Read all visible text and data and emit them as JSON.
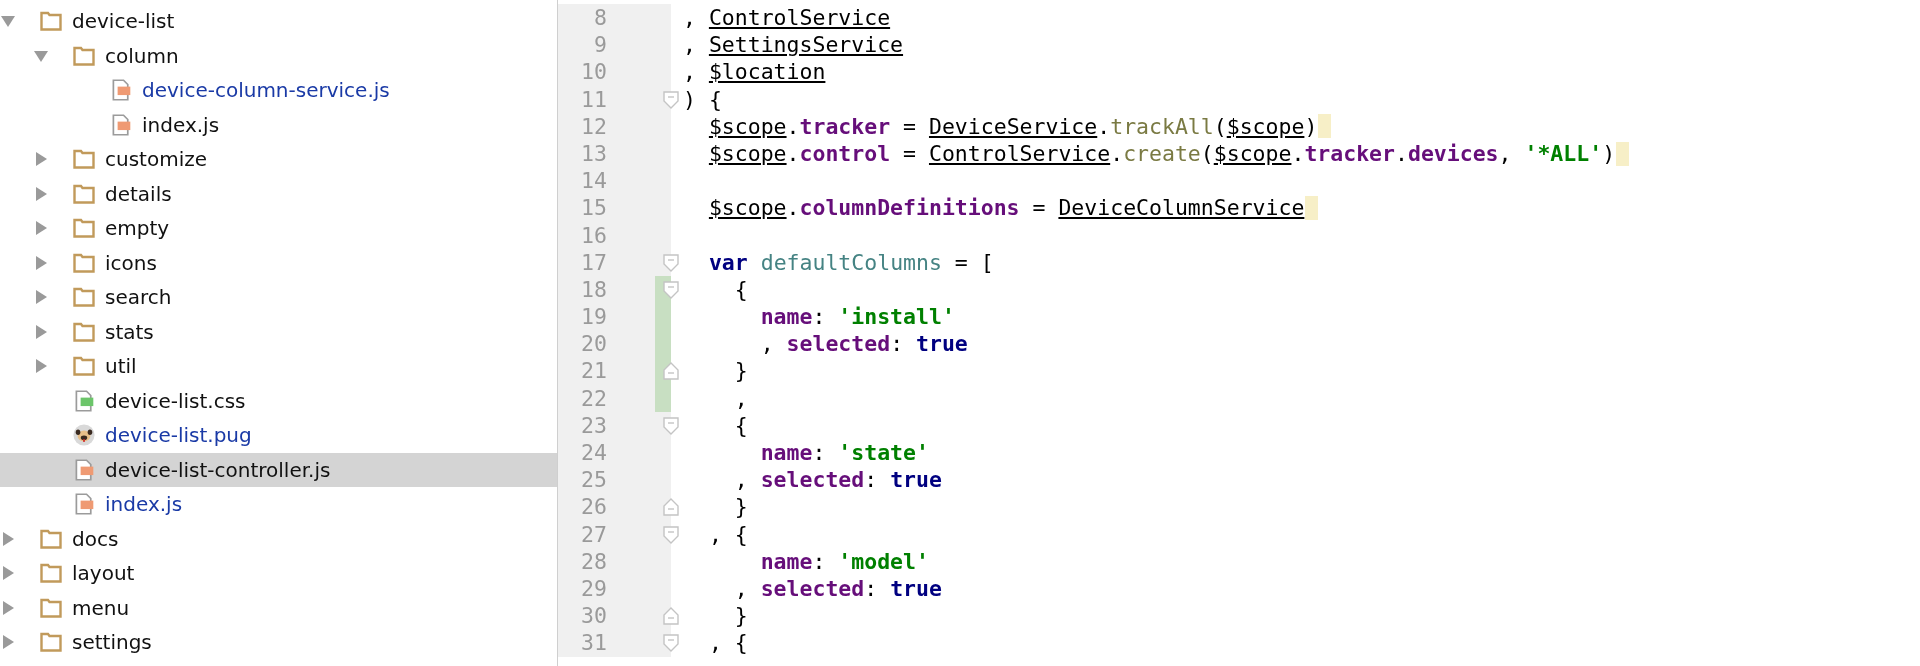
{
  "project_tree": [
    {
      "name": "device-list",
      "kind": "folder",
      "expanded": true,
      "selected": false,
      "modified": false,
      "children": [
        {
          "name": "column",
          "kind": "folder",
          "expanded": true,
          "selected": false,
          "modified": false,
          "children": [
            {
              "name": "device-column-service.js",
              "kind": "js",
              "selected": false,
              "modified": true
            },
            {
              "name": "index.js",
              "kind": "js",
              "selected": false,
              "modified": false
            }
          ]
        },
        {
          "name": "customize",
          "kind": "folder",
          "expanded": false,
          "selected": false,
          "modified": false
        },
        {
          "name": "details",
          "kind": "folder",
          "expanded": false,
          "selected": false,
          "modified": false
        },
        {
          "name": "empty",
          "kind": "folder",
          "expanded": false,
          "selected": false,
          "modified": false
        },
        {
          "name": "icons",
          "kind": "folder",
          "expanded": false,
          "selected": false,
          "modified": false
        },
        {
          "name": "search",
          "kind": "folder",
          "expanded": false,
          "selected": false,
          "modified": false
        },
        {
          "name": "stats",
          "kind": "folder",
          "expanded": false,
          "selected": false,
          "modified": false
        },
        {
          "name": "util",
          "kind": "folder",
          "expanded": false,
          "selected": false,
          "modified": false
        },
        {
          "name": "device-list.css",
          "kind": "css",
          "selected": false,
          "modified": false
        },
        {
          "name": "device-list.pug",
          "kind": "pug",
          "selected": false,
          "modified": true
        },
        {
          "name": "device-list-controller.js",
          "kind": "js",
          "selected": true,
          "modified": false
        },
        {
          "name": "index.js",
          "kind": "js",
          "selected": false,
          "modified": true
        }
      ]
    },
    {
      "name": "docs",
      "kind": "folder",
      "expanded": false,
      "selected": false,
      "modified": false
    },
    {
      "name": "layout",
      "kind": "folder",
      "expanded": false,
      "selected": false,
      "modified": false
    },
    {
      "name": "menu",
      "kind": "folder",
      "expanded": false,
      "selected": false,
      "modified": false
    },
    {
      "name": "settings",
      "kind": "folder",
      "expanded": false,
      "selected": false,
      "modified": false
    }
  ],
  "editor": {
    "lines": [
      {
        "number": "8",
        "fold_start": false,
        "fold_end": false,
        "changed": false,
        "highlight": false,
        "tokens": [
          {
            "t": ", ",
            "kind": "plain"
          },
          {
            "t": "ControlService",
            "kind": "ref"
          }
        ]
      },
      {
        "number": "9",
        "fold_start": false,
        "fold_end": false,
        "changed": false,
        "highlight": false,
        "tokens": [
          {
            "t": ", ",
            "kind": "plain"
          },
          {
            "t": "SettingsService",
            "kind": "ref"
          }
        ]
      },
      {
        "number": "10",
        "fold_start": false,
        "fold_end": false,
        "changed": false,
        "highlight": false,
        "tokens": [
          {
            "t": ", ",
            "kind": "plain"
          },
          {
            "t": "$location",
            "kind": "ref"
          }
        ]
      },
      {
        "number": "11",
        "fold_start": true,
        "fold_end": false,
        "changed": false,
        "highlight": false,
        "tokens": [
          {
            "t": ") {",
            "kind": "plain"
          }
        ]
      },
      {
        "number": "12",
        "fold_start": false,
        "fold_end": false,
        "changed": false,
        "highlight": true,
        "tokens": [
          {
            "t": "  $scope",
            "kind": "ref"
          },
          {
            "t": ".",
            "kind": "plain"
          },
          {
            "t": "tracker",
            "kind": "prop"
          },
          {
            "t": " = ",
            "kind": "plain"
          },
          {
            "t": "DeviceService",
            "kind": "ref"
          },
          {
            "t": ".",
            "kind": "plain"
          },
          {
            "t": "trackAll",
            "kind": "fn"
          },
          {
            "t": "(",
            "kind": "plain"
          },
          {
            "t": "$scope",
            "kind": "ref"
          },
          {
            "t": ")",
            "kind": "plain"
          }
        ]
      },
      {
        "number": "13",
        "fold_start": false,
        "fold_end": false,
        "changed": false,
        "highlight": true,
        "tokens": [
          {
            "t": "  $scope",
            "kind": "ref"
          },
          {
            "t": ".",
            "kind": "plain"
          },
          {
            "t": "control",
            "kind": "prop"
          },
          {
            "t": " = ",
            "kind": "plain"
          },
          {
            "t": "ControlService",
            "kind": "ref"
          },
          {
            "t": ".",
            "kind": "plain"
          },
          {
            "t": "create",
            "kind": "fn"
          },
          {
            "t": "(",
            "kind": "plain"
          },
          {
            "t": "$scope",
            "kind": "ref"
          },
          {
            "t": ".",
            "kind": "plain"
          },
          {
            "t": "tracker",
            "kind": "prop"
          },
          {
            "t": ".",
            "kind": "plain"
          },
          {
            "t": "devices",
            "kind": "prop"
          },
          {
            "t": ", ",
            "kind": "plain"
          },
          {
            "t": "'*ALL'",
            "kind": "str"
          },
          {
            "t": ")",
            "kind": "plain"
          }
        ]
      },
      {
        "number": "14",
        "fold_start": false,
        "fold_end": false,
        "changed": false,
        "highlight": false
      },
      {
        "number": "15",
        "fold_start": false,
        "fold_end": false,
        "changed": false,
        "highlight": true,
        "tokens": [
          {
            "t": "  $scope",
            "kind": "ref"
          },
          {
            "t": ".",
            "kind": "plain"
          },
          {
            "t": "columnDefinitions",
            "kind": "prop"
          },
          {
            "t": " = ",
            "kind": "plain"
          },
          {
            "t": "DeviceColumnService",
            "kind": "ref"
          }
        ]
      },
      {
        "number": "16",
        "fold_start": false,
        "fold_end": false,
        "changed": false,
        "highlight": false
      },
      {
        "number": "17",
        "fold_start": true,
        "fold_end": false,
        "changed": false,
        "highlight": false,
        "tokens": [
          {
            "t": "  var",
            "kind": "kw"
          },
          {
            "t": " defaultColumns",
            "kind": "var"
          },
          {
            "t": " = [",
            "kind": "plain"
          }
        ]
      },
      {
        "number": "18",
        "fold_start": true,
        "fold_end": false,
        "changed": true,
        "highlight": false,
        "tokens": [
          {
            "t": "    {",
            "kind": "plain"
          }
        ]
      },
      {
        "number": "19",
        "fold_start": false,
        "fold_end": false,
        "changed": true,
        "highlight": false,
        "tokens": [
          {
            "t": "      name",
            "kind": "prop"
          },
          {
            "t": ": ",
            "kind": "plain"
          },
          {
            "t": "'install'",
            "kind": "str"
          }
        ]
      },
      {
        "number": "20",
        "fold_start": false,
        "fold_end": false,
        "changed": true,
        "highlight": false,
        "tokens": [
          {
            "t": "      , ",
            "kind": "plain"
          },
          {
            "t": "selected",
            "kind": "prop"
          },
          {
            "t": ": ",
            "kind": "plain"
          },
          {
            "t": "true",
            "kind": "kw"
          }
        ]
      },
      {
        "number": "21",
        "fold_start": false,
        "fold_end": true,
        "changed": true,
        "highlight": false,
        "tokens": [
          {
            "t": "    }",
            "kind": "plain"
          }
        ]
      },
      {
        "number": "22",
        "fold_start": false,
        "fold_end": false,
        "changed": true,
        "highlight": false,
        "tokens": [
          {
            "t": "    ,",
            "kind": "plain"
          }
        ]
      },
      {
        "number": "23",
        "fold_start": true,
        "fold_end": false,
        "changed": false,
        "highlight": false,
        "tokens": [
          {
            "t": "    {",
            "kind": "plain"
          }
        ]
      },
      {
        "number": "24",
        "fold_start": false,
        "fold_end": false,
        "changed": false,
        "highlight": false,
        "tokens": [
          {
            "t": "      name",
            "kind": "prop"
          },
          {
            "t": ": ",
            "kind": "plain"
          },
          {
            "t": "'state'",
            "kind": "str"
          }
        ]
      },
      {
        "number": "25",
        "fold_start": false,
        "fold_end": false,
        "changed": false,
        "highlight": false,
        "tokens": [
          {
            "t": "    , ",
            "kind": "plain"
          },
          {
            "t": "selected",
            "kind": "prop"
          },
          {
            "t": ": ",
            "kind": "plain"
          },
          {
            "t": "true",
            "kind": "kw"
          }
        ]
      },
      {
        "number": "26",
        "fold_start": false,
        "fold_end": true,
        "changed": false,
        "highlight": false,
        "tokens": [
          {
            "t": "    }",
            "kind": "plain"
          }
        ]
      },
      {
        "number": "27",
        "fold_start": true,
        "fold_end": false,
        "changed": false,
        "highlight": false,
        "tokens": [
          {
            "t": "  , {",
            "kind": "plain"
          }
        ]
      },
      {
        "number": "28",
        "fold_start": false,
        "fold_end": false,
        "changed": false,
        "highlight": false,
        "tokens": [
          {
            "t": "      name",
            "kind": "prop"
          },
          {
            "t": ": ",
            "kind": "plain"
          },
          {
            "t": "'model'",
            "kind": "str"
          }
        ]
      },
      {
        "number": "29",
        "fold_start": false,
        "fold_end": false,
        "changed": false,
        "highlight": false,
        "tokens": [
          {
            "t": "    , ",
            "kind": "plain"
          },
          {
            "t": "selected",
            "kind": "prop"
          },
          {
            "t": ": ",
            "kind": "plain"
          },
          {
            "t": "true",
            "kind": "kw"
          }
        ]
      },
      {
        "number": "30",
        "fold_start": false,
        "fold_end": true,
        "changed": false,
        "highlight": false,
        "tokens": [
          {
            "t": "    }",
            "kind": "plain"
          }
        ]
      },
      {
        "number": "31",
        "fold_start": true,
        "fold_end": false,
        "changed": false,
        "highlight": false,
        "tokens": [
          {
            "t": "  , {",
            "kind": "plain"
          }
        ]
      }
    ]
  }
}
